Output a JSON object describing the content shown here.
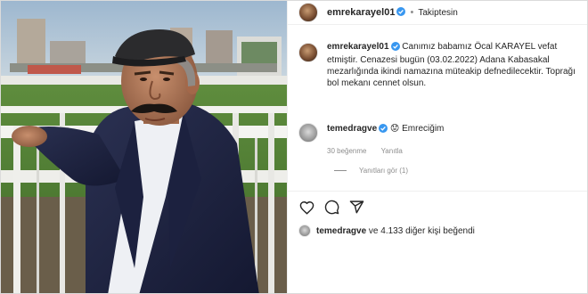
{
  "header": {
    "username": "emrekarayel01",
    "separator": "•",
    "follow_status": "Takiptesin"
  },
  "post": {
    "username": "emrekarayel01",
    "caption": "Canımız babamız Öcal KARAYEL vefat etmiştir. Cenazesi bugün (03.02.2022) Adana Kabasakal mezarlığında ikindi namazına müteakip defnedilecektir. Toprağı bol mekanı cennet olsun."
  },
  "comment": {
    "username": "temedragve",
    "text": "Emreciğim",
    "emoji": "😟",
    "likes": "30 beğenme",
    "reply": "Yanıtla",
    "view_replies": "Yanıtları gör (1)"
  },
  "actions": {
    "like_icon": "heart-icon",
    "comment_icon": "comment-icon",
    "share_icon": "share-icon"
  },
  "likes": {
    "username": "temedragve",
    "text": "ve 4.133 diğer kişi beğendi"
  },
  "colors": {
    "verified": "#3897f0",
    "muted": "#8e8e8e",
    "text": "#262626",
    "border": "#efefef"
  }
}
